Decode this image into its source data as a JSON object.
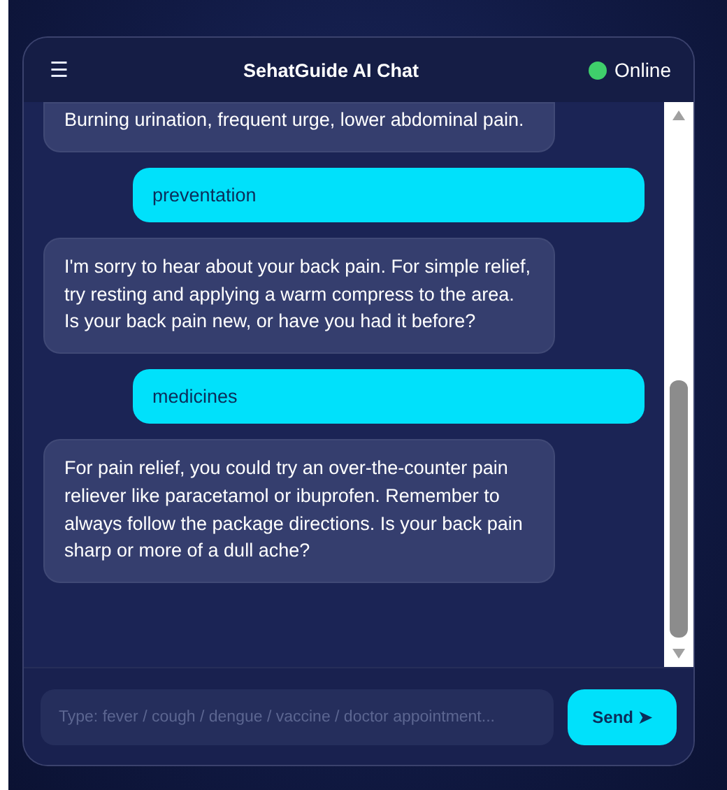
{
  "header": {
    "menu_glyph": "☰",
    "title": "SehatGuide AI Chat",
    "status": {
      "label": "Online",
      "color": "#3fcf6b"
    }
  },
  "messages": [
    {
      "kind": "bot",
      "text": "Burning urination, frequent urge, lower abdominal pain.",
      "cut_top": true
    },
    {
      "kind": "user",
      "text": "preventation"
    },
    {
      "kind": "bot",
      "text": "I'm sorry to hear about your back pain. For simple relief, try resting and applying a warm compress to the area. Is your back pain new, or have you had it before?"
    },
    {
      "kind": "user",
      "text": "medicines"
    },
    {
      "kind": "bot",
      "text": "For pain relief, you could try an over-the-counter pain reliever like paracetamol or ibuprofen. Remember to always follow the package directions. Is your back pain sharp or more of a dull ache?"
    }
  ],
  "composer": {
    "placeholder": "Type: fever / cough / dengue / vaccine / doctor appointment...",
    "send_label": "Send ➤"
  }
}
